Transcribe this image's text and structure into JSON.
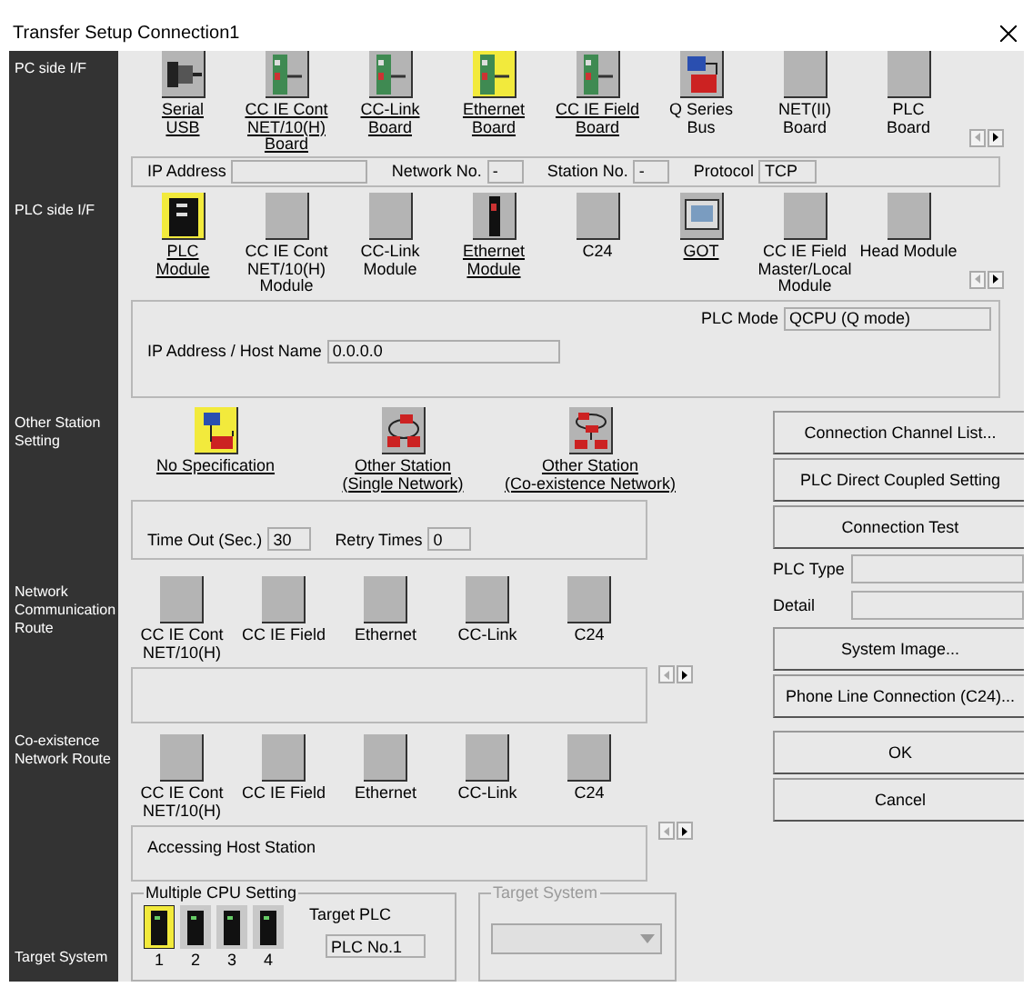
{
  "window": {
    "title": "Transfer Setup Connection1"
  },
  "pc_side": {
    "label": "PC side I/F",
    "items": [
      {
        "label": "Serial\nUSB",
        "kind": "cable",
        "available": true,
        "selected": false
      },
      {
        "label": "CC IE Cont\nNET/10(H)\nBoard",
        "kind": "board",
        "available": true,
        "selected": false
      },
      {
        "label": "CC-Link\nBoard",
        "kind": "board",
        "available": true,
        "selected": false
      },
      {
        "label": "Ethernet\nBoard",
        "kind": "board",
        "available": true,
        "selected": true
      },
      {
        "label": "CC IE Field\nBoard",
        "kind": "board",
        "available": true,
        "selected": false
      },
      {
        "label": "Q Series\nBus",
        "kind": "bus",
        "available": false,
        "selected": false
      },
      {
        "label": "NET(II)\nBoard",
        "kind": "blank",
        "available": false,
        "selected": false
      },
      {
        "label": "PLC\nBoard",
        "kind": "blank",
        "available": false,
        "selected": false
      }
    ],
    "fields": [
      {
        "label": "IP Address"
      },
      {
        "label": "Network No.",
        "value": "-"
      },
      {
        "label": "Station No.",
        "value": "-"
      },
      {
        "label": "Protocol",
        "value": "TCP"
      }
    ]
  },
  "plc_side": {
    "label": "PLC side I/F",
    "items": [
      {
        "label": "PLC\nModule",
        "kind": "plc",
        "available": true,
        "selected": true
      },
      {
        "label": "CC IE Cont\nNET/10(H)\nModule",
        "kind": "blank",
        "available": false,
        "selected": false
      },
      {
        "label": "CC-Link\nModule",
        "kind": "blank",
        "available": false,
        "selected": false
      },
      {
        "label": "Ethernet\nModule",
        "kind": "module",
        "available": true,
        "selected": false
      },
      {
        "label": "C24",
        "kind": "blank",
        "available": false,
        "selected": false
      },
      {
        "label": "GOT",
        "kind": "screen",
        "available": true,
        "selected": false
      },
      {
        "label": "CC IE Field\nMaster/Local\nModule",
        "kind": "blank",
        "available": false,
        "selected": false
      },
      {
        "label": "Head Module",
        "kind": "blank",
        "available": false,
        "selected": false
      }
    ],
    "plc_mode": {
      "label": "PLC Mode",
      "value": "QCPU (Q mode)"
    },
    "host": {
      "label": "IP Address / Host Name",
      "value": "0.0.0.0"
    }
  },
  "other_station": {
    "label": "Other Station Setting",
    "items": [
      {
        "label": "No Specification",
        "kind": "station",
        "available": true,
        "selected": true
      },
      {
        "label": "Other Station\n(Single Network)",
        "kind": "network",
        "available": true,
        "selected": false
      },
      {
        "label": "Other Station\n(Co-existence Network)",
        "kind": "network2",
        "available": true,
        "selected": false
      }
    ],
    "time_out": {
      "label": "Time Out (Sec.)",
      "value": "30"
    },
    "retry": {
      "label": "Retry Times",
      "value": "0"
    }
  },
  "network_route": {
    "label": "Network Communication Route",
    "items": [
      {
        "label": "CC IE Cont\nNET/10(H)",
        "available": false,
        "selected": false
      },
      {
        "label": "CC IE Field",
        "available": false,
        "selected": false
      },
      {
        "label": "Ethernet",
        "available": false,
        "selected": false
      },
      {
        "label": "CC-Link",
        "available": false,
        "selected": false
      },
      {
        "label": "C24",
        "available": false,
        "selected": false
      }
    ]
  },
  "coexistence_route": {
    "label": "Co-existence Network Route",
    "items": [
      {
        "label": "CC IE Cont\nNET/10(H)",
        "available": false,
        "selected": false
      },
      {
        "label": "CC IE Field",
        "available": false,
        "selected": false
      },
      {
        "label": "Ethernet",
        "available": false,
        "selected": false
      },
      {
        "label": "CC-Link",
        "available": false,
        "selected": false
      },
      {
        "label": "C24",
        "available": false,
        "selected": false
      }
    ],
    "message": "Accessing Host Station"
  },
  "side_panel": {
    "buttons_top": [
      "Connection Channel List...",
      "PLC Direct Coupled Setting",
      "Connection Test"
    ],
    "plc_type": {
      "label": "PLC Type"
    },
    "detail": {
      "label": "Detail"
    },
    "buttons_bottom": [
      "System Image...",
      "Phone Line Connection (C24)..."
    ],
    "ok": "OK",
    "cancel": "Cancel"
  },
  "target_system": {
    "label": "Target System",
    "multiple_cpu": {
      "title": "Multiple CPU Setting",
      "cpus": [
        {
          "label": "1",
          "selected": true
        },
        {
          "label": "2",
          "selected": false
        },
        {
          "label": "3",
          "selected": false
        },
        {
          "label": "4",
          "selected": false
        }
      ],
      "target_plc": {
        "label": "Target PLC",
        "value": "PLC No.1"
      }
    },
    "target_group": {
      "title": "Target System",
      "disabled": true
    }
  }
}
